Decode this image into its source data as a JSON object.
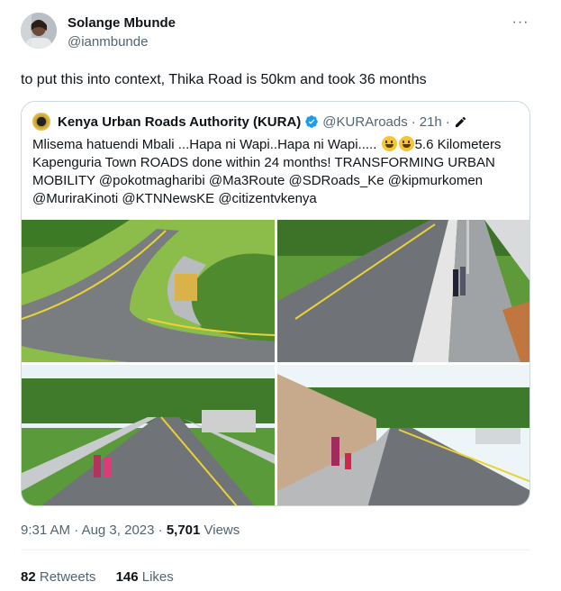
{
  "author": {
    "name": "Solange Mbunde",
    "handle": "@ianmbunde"
  },
  "more_label": "···",
  "text": "to put this into context, Thika Road is 50km and took 36 months",
  "quote": {
    "name": "Kenya Urban Roads Authority (KURA)",
    "handle": "@KURAroads",
    "dot": "·",
    "time": "21h",
    "dot2": "·",
    "lines": [
      "Mlisema hatuendi Mbali ...Hapa ni Wapi..Hapa ni Wapi.....",
      "5.6 Kilometers",
      "Kapenguria Town ROADS done within 24 months! TRANSFORMING URBAN",
      "MOBILITY @pokotmagharibi @Ma3Route @SDRoads_Ke @kipmurkomen",
      "@MuriraKinoti @KTNNewsKE @citizentvkenya"
    ],
    "images": [
      "curved-road-photo",
      "road-with-pedestrians-photo",
      "straight-road-photo",
      "road-with-wall-photo"
    ]
  },
  "meta": {
    "time": "9:31 AM",
    "dot": "·",
    "date": "Aug 3, 2023",
    "dot2": "·",
    "views_count": "5,701",
    "views_label": " Views"
  },
  "stats": {
    "retweets_count": "82",
    "retweets_label": " Retweets",
    "likes_count": "146",
    "likes_label": " Likes"
  },
  "colors": {
    "text": "#0f1419",
    "secondary": "#536471",
    "border": "#cfd9de",
    "verified": "#1d9bf0"
  },
  "icons": [
    "avatar",
    "more-icon",
    "kura-logo-icon",
    "verified-badge-icon",
    "edited-pencil-icon",
    "smiley-emoji-icon"
  ]
}
